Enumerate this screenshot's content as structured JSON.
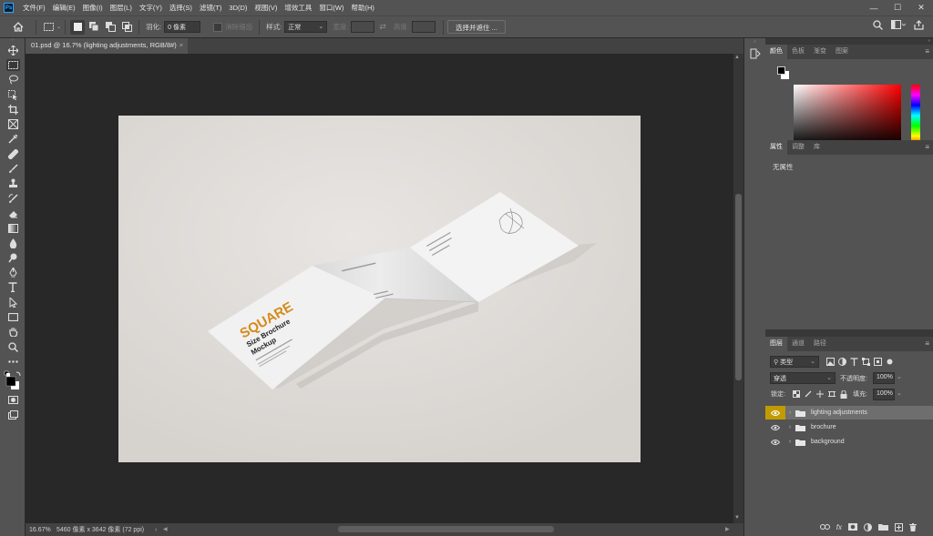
{
  "menubar": {
    "logo": "Ps",
    "items": [
      "文件(F)",
      "编辑(E)",
      "图像(I)",
      "图层(L)",
      "文字(Y)",
      "选择(S)",
      "滤镜(T)",
      "3D(D)",
      "视图(V)",
      "增效工具",
      "窗口(W)",
      "帮助(H)"
    ],
    "controls": [
      "—",
      "☐",
      "✕"
    ]
  },
  "options": {
    "feather_label": "羽化:",
    "feather_value": "0 像素",
    "antialias_label": "消除锯齿",
    "style_label": "样式:",
    "style_value": "正常",
    "width_label": "宽度:",
    "height_label": "高度:",
    "select_mask_label": "选择并遮住 ..."
  },
  "document": {
    "tab_title": "01.psd @ 16.7% (lighting adjustments, RGB/8#)",
    "close": "×"
  },
  "status": {
    "zoom": "16.67%",
    "info": "5460 像素 x 3642 像素 (72 ppi)",
    "arrow": "›"
  },
  "mockup": {
    "title": "SQUARE",
    "subtitle1": "Size Brochure",
    "subtitle2": "Mockup"
  },
  "color_panel": {
    "tabs": [
      "颜色",
      "色板",
      "渐变",
      "图案"
    ],
    "fg_color": "#000000",
    "bg_color": "#ffffff"
  },
  "properties_panel": {
    "tabs": [
      "属性",
      "调整",
      "库"
    ],
    "empty_text": "无属性"
  },
  "layers_panel": {
    "tabs": [
      "图层",
      "通道",
      "路径"
    ],
    "filter_kind": "类型",
    "blend_mode": "穿透",
    "opacity_label": "不透明度:",
    "opacity_value": "100%",
    "lock_label": "锁定:",
    "fill_label": "填充:",
    "fill_value": "100%",
    "layers": [
      {
        "name": "lighting adjustments",
        "selected": true
      },
      {
        "name": "brochure",
        "selected": false
      },
      {
        "name": "background",
        "selected": false
      }
    ]
  },
  "colors": {
    "accent": "#c19b00",
    "brand_orange": "#d58a1a",
    "selection_blue": "#31a8ff"
  }
}
